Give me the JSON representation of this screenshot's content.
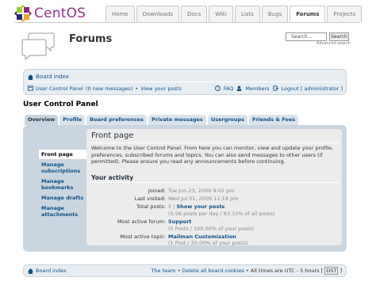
{
  "header": {
    "logo_text": "CentOS",
    "nav_tabs": [
      "Home",
      "Downloads",
      "Docs",
      "Wiki",
      "Lists",
      "Bugs",
      "Forums",
      "Projects"
    ],
    "active_tab": "Forums"
  },
  "section": {
    "title": "Forums",
    "search_placeholder": "Search...",
    "search_button": "Search",
    "advanced_search": "Advanced search"
  },
  "navbar": {
    "board_index": "Board index",
    "ucp_link": "User Control Panel",
    "new_messages": "(0 new messages)",
    "separator": "•",
    "view_posts": "View your posts",
    "faq": "FAQ",
    "members": "Members",
    "logout": "Logout [ administrator ]"
  },
  "ucp": {
    "title": "User Control Panel",
    "tabs": [
      "Overview",
      "Profile",
      "Board preferences",
      "Private messages",
      "Usergroups",
      "Friends & Foes"
    ],
    "side_menu": [
      "Front page",
      "Manage subscriptions",
      "Manage bookmarks",
      "Manage drafts",
      "Manage attachments"
    ],
    "main_title": "Front page",
    "welcome": "Welcome to the User Control Panel. From here you can monitor, view and update your profile, preferences, subscribed forums and topics. You can also send messages to other users (if permitted). Please ensure you read any announcements before continuing.",
    "activity_title": "Your activity",
    "stats": {
      "joined_label": "Joined:",
      "joined": "Tue Jun 23, 2009 9:02 pm",
      "last_visited_label": "Last visited:",
      "last_visited": "Wed Jul 01, 2009 11:19 pm",
      "total_posts_label": "Total posts:",
      "total_posts_count": "5 |",
      "show_posts": "Show your posts",
      "posts_detail": "(0.56 posts per day / 83.33% of all posts)",
      "most_active_forum_label": "Most active forum:",
      "most_active_forum": "Support",
      "forum_detail": "(5 Posts / 100.00% of your posts)",
      "most_active_topic_label": "Most active topic:",
      "most_active_topic": "Mailman Customization",
      "topic_detail": "(1 Post / 20.00% of your posts)"
    }
  },
  "footer": {
    "board_index": "Board index",
    "the_team": "The team",
    "delete_cookies": "Delete all board cookies",
    "timezone_prefix": "All times are UTC - 5 hours [",
    "dst": "DST",
    "timezone_suffix": "]"
  },
  "colors": {
    "link": "#105289",
    "logo_purple": "#9b2f8e",
    "panel": "#cad5df",
    "navbar_bg": "#e8edf2"
  }
}
